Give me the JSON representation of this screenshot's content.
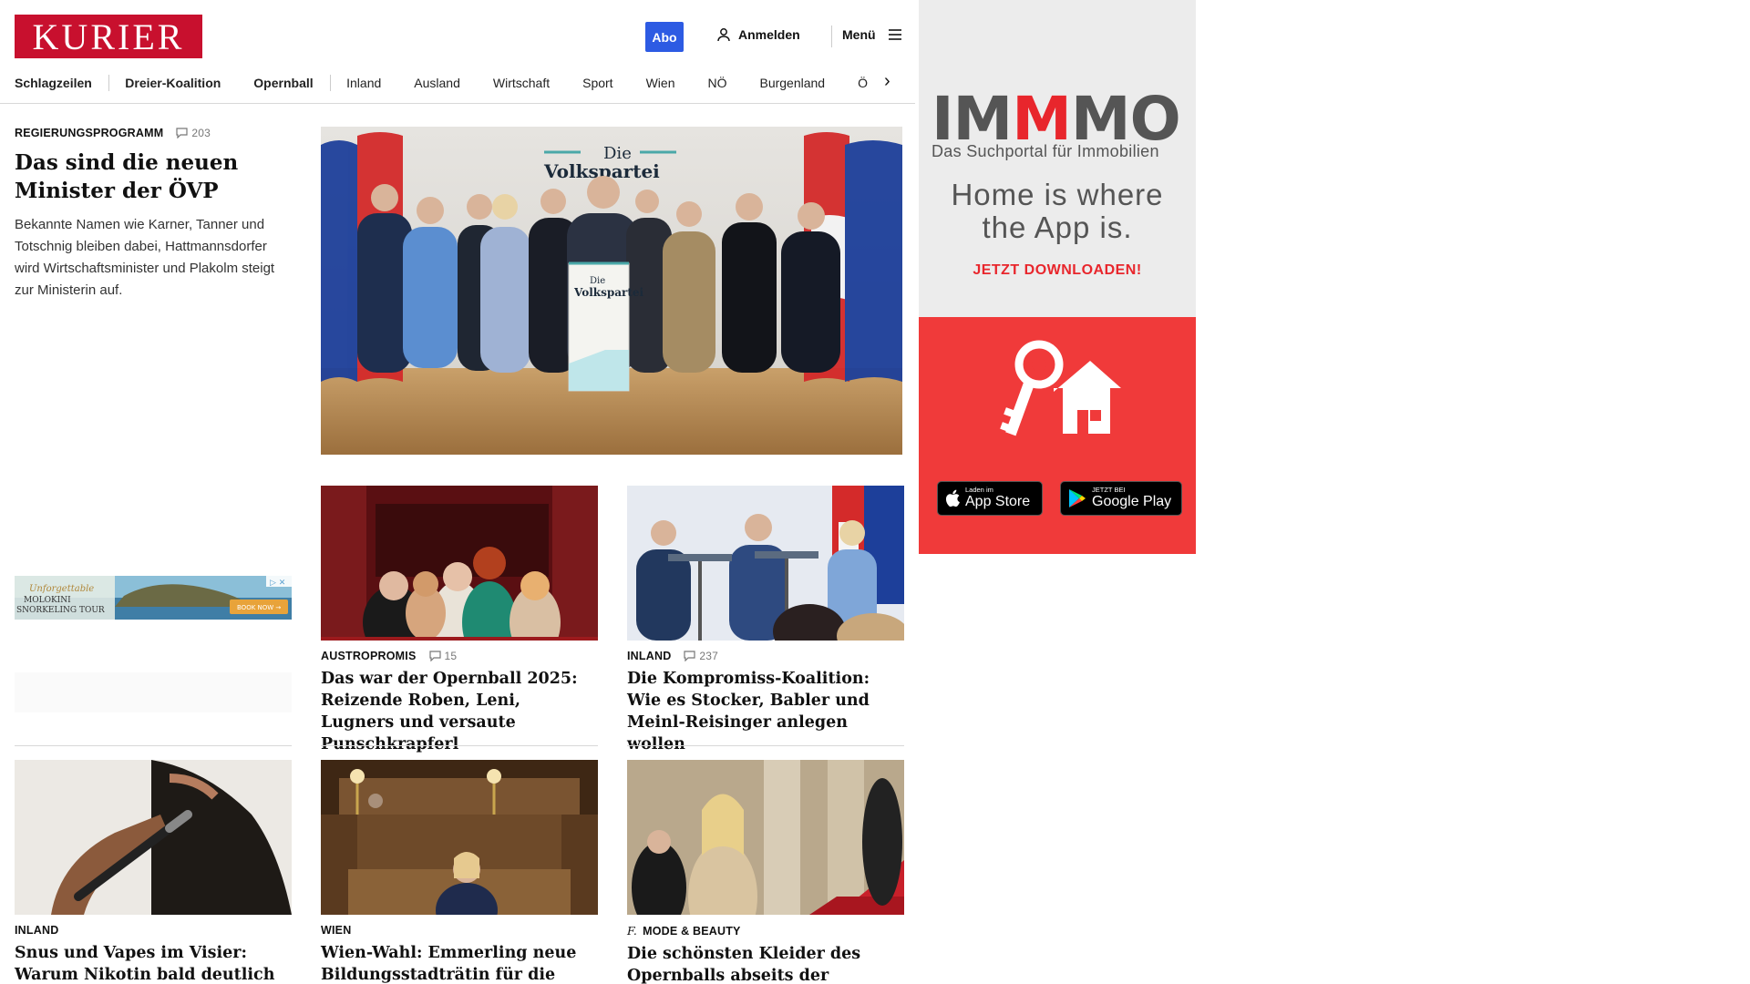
{
  "header": {
    "logo": "KURIER",
    "abo_label": "Abo",
    "login_label": "Anmelden",
    "menu_label": "Menü"
  },
  "nav": {
    "items": [
      "Schlagzeilen",
      "Dreier-Koalition",
      "Opernball",
      "Inland",
      "Ausland",
      "Wirtschaft",
      "Sport",
      "Wien",
      "NÖ",
      "Burgenland",
      "Ö"
    ],
    "arrow": "›"
  },
  "lead": {
    "kicker": "REGIERUNGSPROGRAMM",
    "comments": "203",
    "title": "Das sind die neuen Minister der ÖVP",
    "teaser": "Bekannte Namen wie Karner, Tanner und Totschnig bleiben dabei, Hattmannsdorfer wird Wirtschaftsminister und Plakolm steigt zur Ministerin auf.",
    "hero_banner": "Die Volkspartei",
    "podium_text": "Die Volkspartei"
  },
  "small_ad": {
    "line1": "Unforgettable",
    "line2": "MOLOKINI SNORKELING TOUR",
    "cta": "BOOK NOW →"
  },
  "cards": [
    {
      "kicker": "AUSTROPROMIS",
      "comments": "15",
      "title": "Das war der Opernball 2025: Reizende Roben, Leni, Lugners und versaute Punschkrapferl"
    },
    {
      "kicker": "INLAND",
      "comments": "237",
      "title": "Die Kompromiss-Koalition: Wie es Stocker, Babler und Meinl-Reisinger anlegen wollen"
    },
    {
      "kicker": "INLAND",
      "title": "Snus und Vapes im Visier: Warum Nikotin bald deutlich teurer wird"
    },
    {
      "kicker": "WIEN",
      "title": "Wien-Wahl: Emmerling neue Bildungsstadträtin für die Neos"
    },
    {
      "kicker": "MODE & BEAUTY",
      "brand_mark": "f.",
      "title": "Die schönsten Kleider des Opernballs abseits der Kameras"
    }
  ],
  "side_ad": {
    "brand_a": "IM",
    "brand_b": "M",
    "brand_c": "MO",
    "subtitle": "Das Suchportal für Immobilien",
    "headline_1": "Home is where",
    "headline_2": "the App is.",
    "cta": "JETZT DOWNLOADEN!",
    "apple_small": "Laden im",
    "apple_big": "App Store",
    "google_small": "JETZT BEI",
    "google_big": "Google Play"
  },
  "colors": {
    "brand_red": "#c8102e",
    "abo_blue": "#2d5be3",
    "ad_red": "#f03a3a"
  }
}
